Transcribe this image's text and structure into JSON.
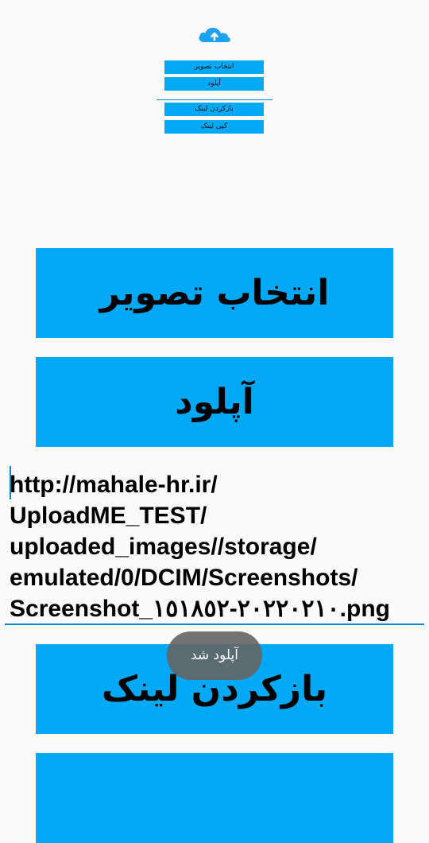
{
  "colors": {
    "accent": "#03a9f4",
    "underline": "#0288d1",
    "background": "#fafafa",
    "toast_bg": "#646464"
  },
  "logo": {
    "icon": "cloud-upload-icon"
  },
  "preview": {
    "select_label": "انتخاب تصویر",
    "upload_label": "آپلود",
    "open_link_label": "بازکردن لینک",
    "copy_link_label": "کپی لینک"
  },
  "main": {
    "select_label": "انتخاب تصویر",
    "upload_label": "آپلود",
    "link_value": "http://mahale-hr.ir/\nUploadME_TEST/\nuploaded_images//storage/\nemulated/0/DCIM/Screenshots/\nScreenshot_٢٠٢٢٠٢١٠-١٥١٨٥٢.png",
    "open_link_label": "بازکردن لینک"
  },
  "toast": {
    "message": "آپلود شد"
  }
}
